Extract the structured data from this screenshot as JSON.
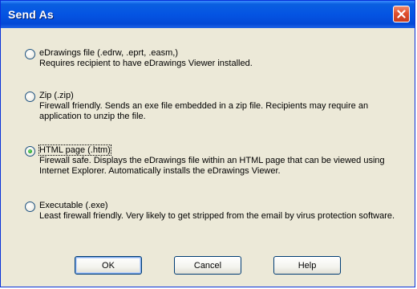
{
  "window": {
    "title": "Send As"
  },
  "options": [
    {
      "label": "eDrawings file (.edrw, .eprt, .easm,)",
      "description": "Requires recipient to have eDrawings Viewer installed.",
      "selected": false
    },
    {
      "label": "Zip (.zip)",
      "description": "Firewall friendly. Sends an exe file embedded in a zip file. Recipients may require an application to unzip the file.",
      "selected": false
    },
    {
      "label": "HTML page (.htm)",
      "description": "Firewall safe. Displays the eDrawings file within an HTML page that can be viewed using Internet Explorer. Automatically installs the eDrawings Viewer.",
      "selected": true
    },
    {
      "label": "Executable (.exe)",
      "description": "Least firewall friendly. Very likely to get stripped from the email by virus protection software.",
      "selected": false
    }
  ],
  "buttons": {
    "ok": "OK",
    "cancel": "Cancel",
    "help": "Help"
  },
  "colors": {
    "title_bar": "#0454e3",
    "dialog_bg": "#ece9d8",
    "close_button": "#e0502e",
    "selected_radio": "#21a121"
  }
}
